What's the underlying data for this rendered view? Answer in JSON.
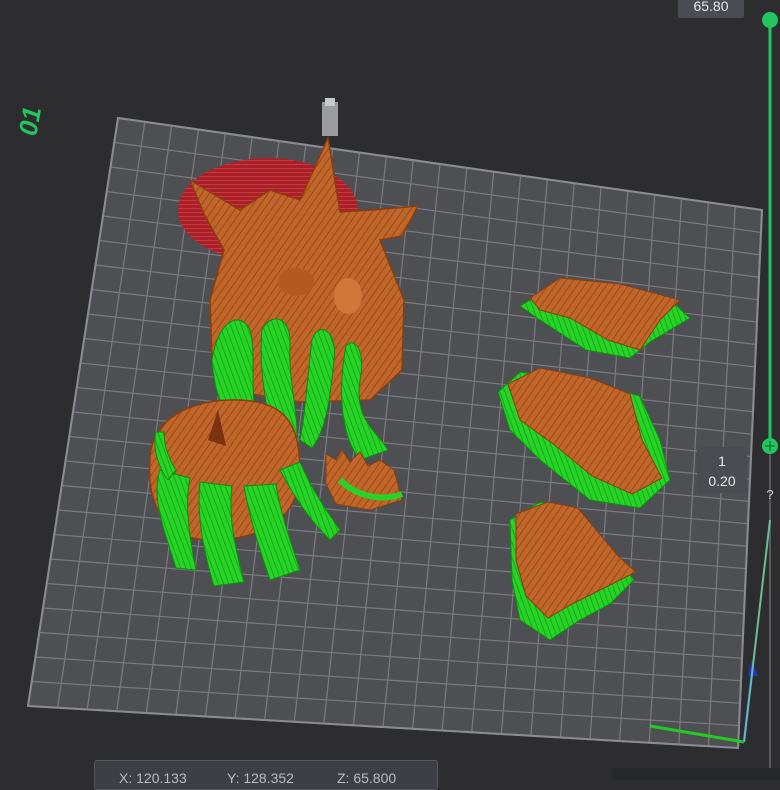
{
  "plate": {
    "label": "01"
  },
  "layer_slider": {
    "top_value": "65.80",
    "bottom_layer": "1",
    "bottom_height": "0.20",
    "help": "?",
    "accent_color": "#22c55e"
  },
  "coordinates": {
    "x": "X: 120.133",
    "y": "Y: 128.352",
    "z": "Z: 65.800"
  },
  "colors": {
    "model": "#c0662a",
    "support": "#22cc22",
    "bed": "#4e4f53",
    "grid": "#7a7b80",
    "background": "#2d2d30"
  },
  "icons": [
    "axis-gizmo-icon",
    "slider-handle-icon"
  ]
}
